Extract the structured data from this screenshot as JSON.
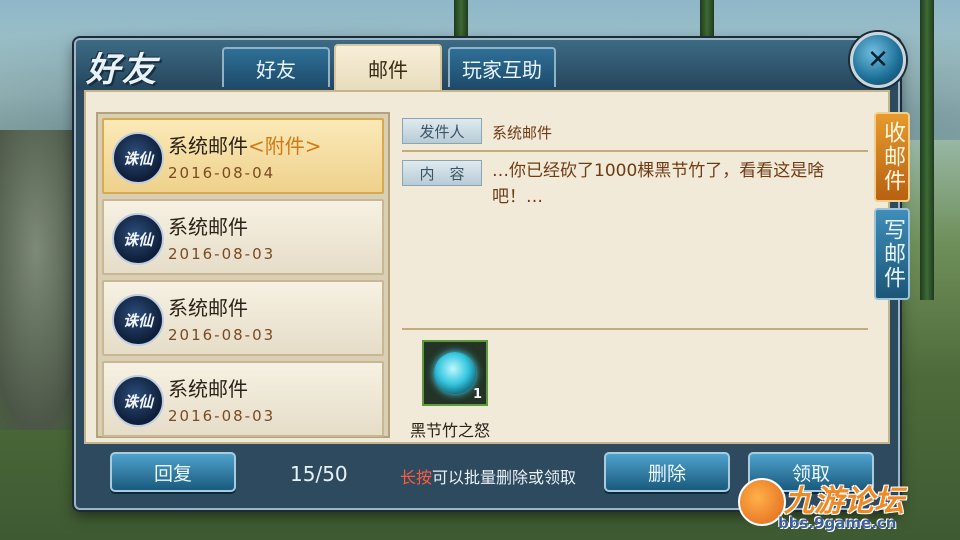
{
  "window": {
    "title": "好友"
  },
  "tabs": [
    {
      "label": "好友",
      "active": false
    },
    {
      "label": "邮件",
      "active": true
    },
    {
      "label": "玩家互助",
      "active": false
    }
  ],
  "mail_list": [
    {
      "sender": "系统邮件",
      "attachment_tag": "<附件>",
      "date": "2016-08-04",
      "selected": true,
      "badge": "诛仙"
    },
    {
      "sender": "系统邮件",
      "attachment_tag": "",
      "date": "2016-08-03",
      "selected": false,
      "badge": "诛仙"
    },
    {
      "sender": "系统邮件",
      "attachment_tag": "",
      "date": "2016-08-03",
      "selected": false,
      "badge": "诛仙"
    },
    {
      "sender": "系统邮件",
      "attachment_tag": "",
      "date": "2016-08-03",
      "selected": false,
      "badge": "诛仙"
    }
  ],
  "detail": {
    "sender_label": "发件人",
    "sender_value": "系统邮件",
    "content_label": "内　容",
    "content_text": "…你已经砍了1000棵黑节竹了，看看这是啥吧！…",
    "attachment": {
      "name": "黑节竹之怒",
      "quantity": "1",
      "icon": "glowing-orb-icon"
    }
  },
  "side_tabs": [
    {
      "label": "收邮件",
      "active": true
    },
    {
      "label": "写邮件",
      "active": false
    }
  ],
  "footer": {
    "reply_label": "回复",
    "page_count": "15/50",
    "hint_highlight": "长按",
    "hint_rest": "可以批量删除或领取",
    "delete_label": "删除",
    "claim_label": "领取"
  },
  "watermark": {
    "brand": "九游论坛",
    "url": "bbs.9game.cn"
  },
  "colors": {
    "accent_orange": "#e69a2e",
    "button_blue": "#2f6f96",
    "highlight_red": "#ff5a3c"
  }
}
